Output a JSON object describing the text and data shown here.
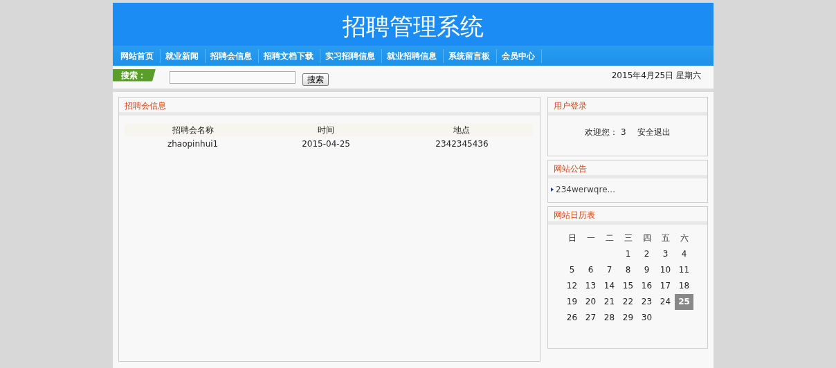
{
  "site_title": "招聘管理系统",
  "nav": [
    {
      "label": "网站首页"
    },
    {
      "label": "就业新闻"
    },
    {
      "label": "招聘会信息"
    },
    {
      "label": "招聘文档下载"
    },
    {
      "label": "实习招聘信息"
    },
    {
      "label": "就业招聘信息"
    },
    {
      "label": "系统留言板"
    },
    {
      "label": "会员中心"
    }
  ],
  "search": {
    "label": "搜索：",
    "button": "搜索",
    "date": "2015年4月25日 星期六"
  },
  "main_panel": {
    "title": "招聘会信息",
    "columns": [
      "招聘会名称",
      "时间",
      "地点"
    ],
    "rows": [
      [
        "zhaopinhui1",
        "2015-04-25",
        "2342345436"
      ]
    ]
  },
  "login_box": {
    "title": "用户登录",
    "welcome": "欢迎您：",
    "user": "3",
    "logout": "安全退出"
  },
  "notice_box": {
    "title": "网站公告",
    "items": [
      "234werwqre..."
    ]
  },
  "calendar_box": {
    "title": "网站日历表",
    "weekdays": [
      "日",
      "一",
      "二",
      "三",
      "四",
      "五",
      "六"
    ],
    "weeks": [
      [
        {
          "day": "1",
          "selected": false
        },
        {
          "day": "2",
          "selected": false
        },
        {
          "day": "3",
          "selected": false
        },
        {
          "day": "4",
          "selected": false
        }
      ],
      [
        {
          "day": "5",
          "selected": false
        },
        {
          "day": "6",
          "selected": false
        },
        {
          "day": "7",
          "selected": false
        },
        {
          "day": "8",
          "selected": false
        },
        {
          "day": "9",
          "selected": false
        },
        {
          "day": "10",
          "selected": false
        },
        {
          "day": "11",
          "selected": false
        }
      ],
      [
        {
          "day": "12",
          "selected": false
        },
        {
          "day": "13",
          "selected": false
        },
        {
          "day": "14",
          "selected": false
        },
        {
          "day": "15",
          "selected": false
        },
        {
          "day": "16",
          "selected": false
        },
        {
          "day": "17",
          "selected": false
        },
        {
          "day": "18",
          "selected": false
        }
      ],
      [
        {
          "day": "19",
          "selected": false
        },
        {
          "day": "20",
          "selected": false
        },
        {
          "day": "21",
          "selected": false
        },
        {
          "day": "22",
          "selected": false
        },
        {
          "day": "23",
          "selected": false
        },
        {
          "day": "24",
          "selected": false
        },
        {
          "day": "25",
          "selected": true
        }
      ],
      [
        {
          "day": "26",
          "selected": false
        },
        {
          "day": "27",
          "selected": false
        },
        {
          "day": "28",
          "selected": false
        },
        {
          "day": "29",
          "selected": false
        },
        {
          "day": "30",
          "selected": false
        }
      ]
    ]
  }
}
